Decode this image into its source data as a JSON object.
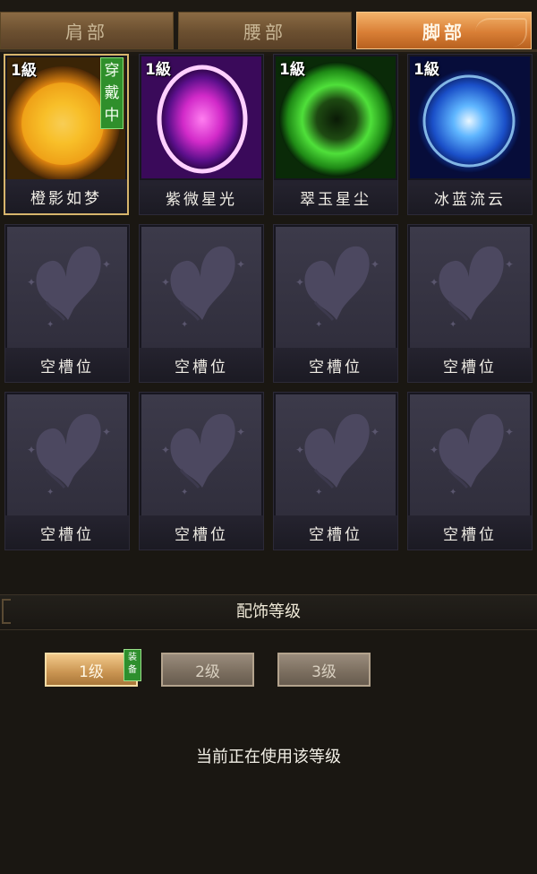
{
  "tabs": [
    {
      "label": "肩部",
      "active": false
    },
    {
      "label": "腰部",
      "active": false
    },
    {
      "label": "脚部",
      "active": true
    }
  ],
  "accessories": [
    {
      "name": "橙影如梦",
      "level": "1級",
      "worn_badge": "穿戴中",
      "theme": "orange-sun",
      "color": "#f2a51c"
    },
    {
      "name": "紫微星光",
      "level": "1級",
      "theme": "purple-ring",
      "color": "#c636d6"
    },
    {
      "name": "翠玉星尘",
      "level": "1級",
      "theme": "green-burst",
      "color": "#39d12e"
    },
    {
      "name": "冰蓝流云",
      "level": "1級",
      "theme": "blue-swirl",
      "color": "#2f8cf0"
    }
  ],
  "empty_slot_label": "空槽位",
  "empty_slot_icon": "butterfly-icon",
  "section": {
    "title": "配饰等级"
  },
  "level_buttons": [
    {
      "label": "1级",
      "active": true
    },
    {
      "label": "2级",
      "active": false
    },
    {
      "label": "3级",
      "active": false
    }
  ],
  "equip_tag": "装备",
  "status": "当前正在使用该等级",
  "colors": {
    "accent_active": "#d97f36",
    "equipped_green": "#2f8f2b",
    "selected_border": "#d7b56c"
  }
}
